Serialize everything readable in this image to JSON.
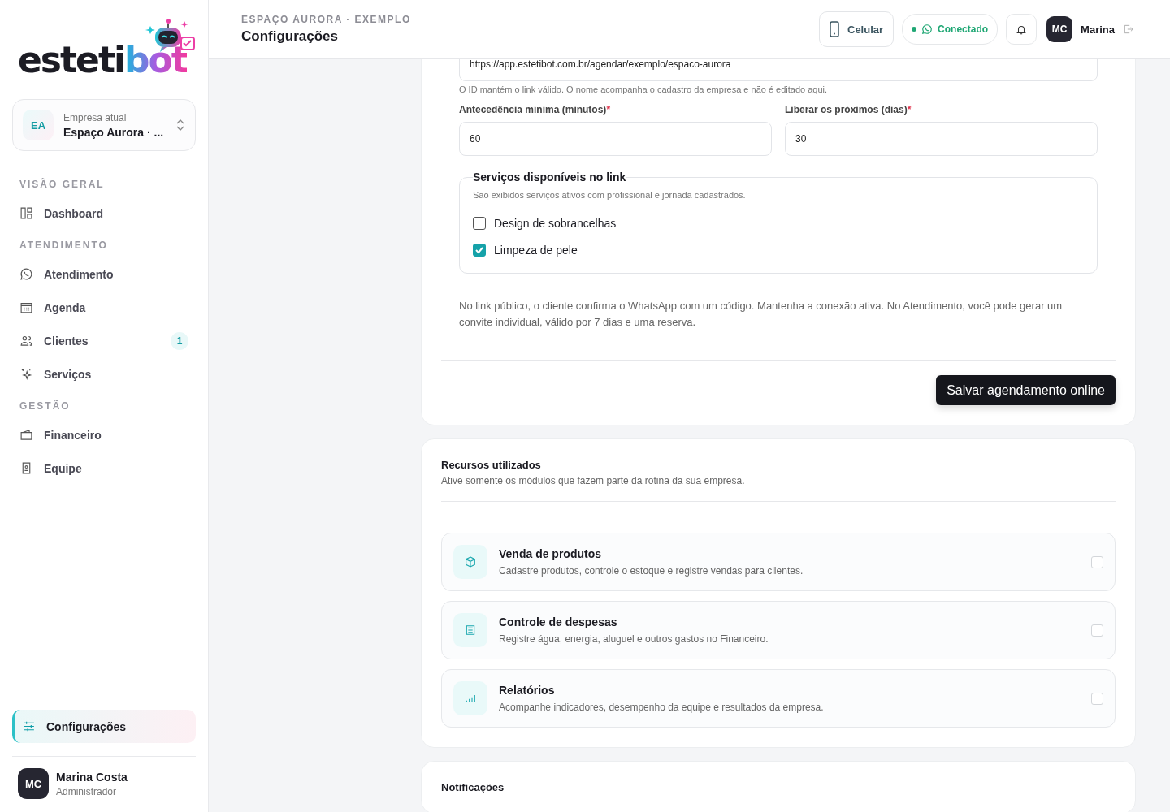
{
  "logo": {
    "plain": "esteti",
    "accent": "bot"
  },
  "company": {
    "initials": "EA",
    "label": "Empresa atual",
    "name": "Espaço Aurora · ..."
  },
  "nav_sections": [
    {
      "title": "VISÃO GERAL",
      "items": [
        {
          "label": "Dashboard",
          "selected": false
        }
      ]
    },
    {
      "title": "ATENDIMENTO",
      "items": [
        {
          "label": "Atendimento",
          "selected": false
        },
        {
          "label": "Agenda",
          "selected": false
        },
        {
          "label": "Clientes",
          "selected": false,
          "badge": "1"
        },
        {
          "label": "Serviços",
          "selected": false
        }
      ]
    },
    {
      "title": "GESTÃO",
      "items": [
        {
          "label": "Financeiro",
          "selected": false
        },
        {
          "label": "Equipe",
          "selected": false
        }
      ]
    }
  ],
  "settings_item": {
    "label": "Configurações",
    "selected": true
  },
  "user": {
    "initials": "MC",
    "name": "Marina Costa",
    "role": "Administrador"
  },
  "header": {
    "breadcrumb": "ESPAÇO AURORA · EXEMPLO",
    "title": "Configurações",
    "device_button": "Celular",
    "status": {
      "label": "Conectado",
      "connected": true
    },
    "avatar": "MC",
    "user_name": "Marina"
  },
  "booking": {
    "link_value": "https://app.estetibot.com.br/agendar/exemplo/espaco-aurora",
    "link_help": "O ID mantém o link válido. O nome acompanha o cadastro da empresa e não é editado aqui.",
    "fields": [
      {
        "label": "Antecedência mínima (minutos)",
        "required_mark": "*",
        "value": "60"
      },
      {
        "label": "Liberar os próximos (dias)",
        "required_mark": "*",
        "value": "30"
      }
    ],
    "services": {
      "legend": "Serviços disponíveis no link",
      "help": "São exibidos serviços ativos com profissional e jornada cadastrados.",
      "items": [
        {
          "label": "Design de sobrancelhas",
          "checked": false
        },
        {
          "label": "Limpeza de pele",
          "checked": true
        }
      ]
    },
    "info": "No link público, o cliente confirma o WhatsApp com um código. Mantenha a conexão ativa. No Atendimento, você pode gerar um convite individual, válido por 7 dias e uma reserva.",
    "save_button": "Salvar agendamento online"
  },
  "resources": {
    "title": "Recursos utilizados",
    "subtitle": "Ative somente os módulos que fazem parte da rotina da sua empresa.",
    "modules": [
      {
        "title": "Venda de produtos",
        "description": "Cadastre produtos, controle o estoque e registre vendas para clientes.",
        "checked": false
      },
      {
        "title": "Controle de despesas",
        "description": "Registre água, energia, aluguel e outros gastos no Financeiro.",
        "checked": false
      },
      {
        "title": "Relatórios",
        "description": "Acompanhe indicadores, desempenho da equipe e resultados da empresa.",
        "checked": false
      }
    ]
  },
  "notifications": {
    "title": "Notificações"
  }
}
